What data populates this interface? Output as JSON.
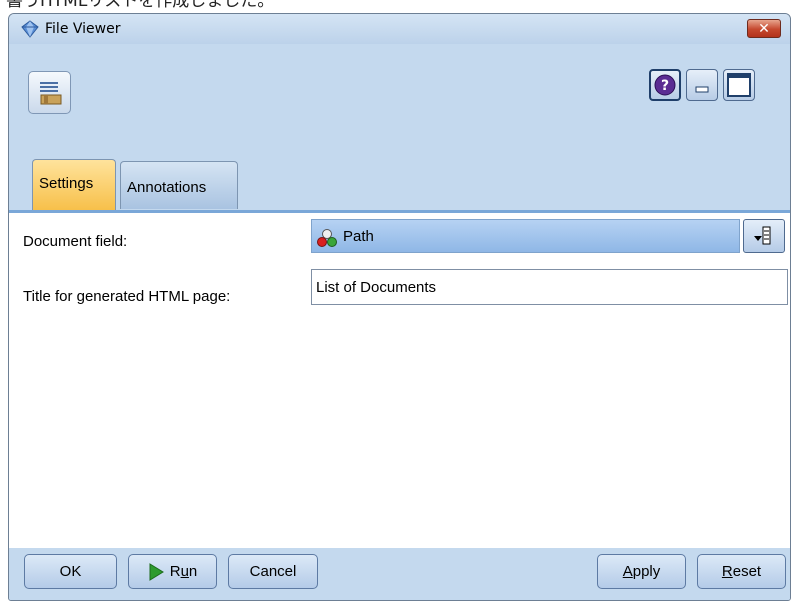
{
  "caption": {
    "text": "書うHTMLリストを作成しました。"
  },
  "window": {
    "title": "File Viewer",
    "close_label": "✕"
  },
  "top_buttons": {
    "help_label": "?"
  },
  "tabs": [
    {
      "label": "Settings",
      "active": true
    },
    {
      "label": "Annotations",
      "active": false
    }
  ],
  "settings": {
    "document_field_label": "Document field:",
    "document_field_value": "Path",
    "title_label": "Title for generated HTML page:",
    "title_value": "List of Documents"
  },
  "buttons": {
    "ok": "OK",
    "run_prefix": "R",
    "run_mnemonic": "u",
    "run_suffix": "n",
    "cancel": "Cancel",
    "apply_mnemonic": "A",
    "apply_suffix": "pply",
    "reset_mnemonic": "R",
    "reset_suffix": "eset"
  },
  "colors": {
    "active_tab": "#f7c04a",
    "content_border": "#7aa7d8",
    "close_button": "#c5482e",
    "run_icon": "#2e9b2e"
  }
}
